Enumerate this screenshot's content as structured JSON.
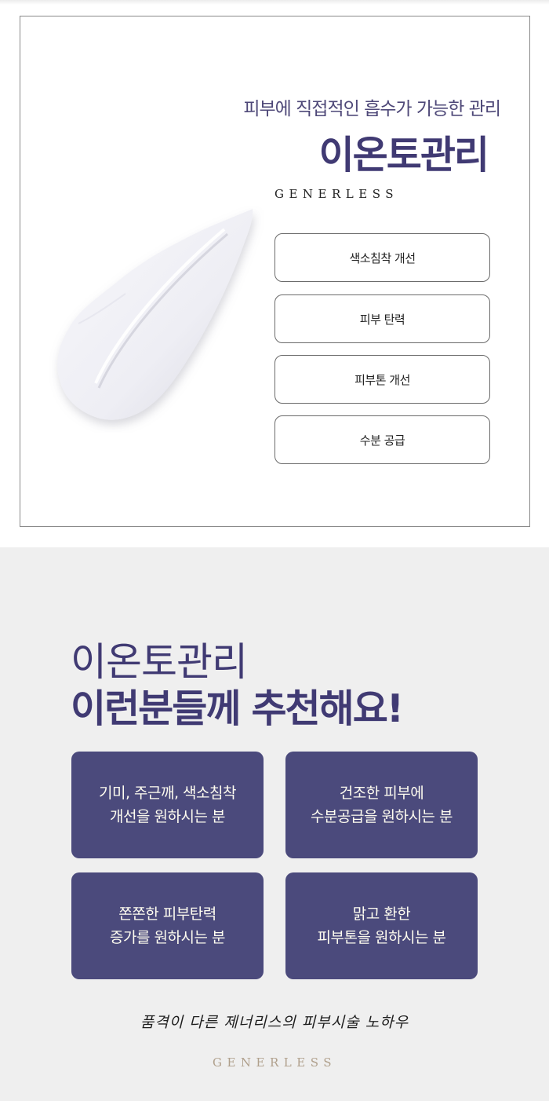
{
  "intro": {
    "subtitle": "피부에 직접적인 흡수가 가능한 관리",
    "title": "이온토관리",
    "brand": "GENERLESS"
  },
  "benefits": [
    {
      "label": "색소침착 개선"
    },
    {
      "label": "피부 탄력"
    },
    {
      "label": "피부톤 개선"
    },
    {
      "label": "수분 공급"
    }
  ],
  "recommend": {
    "title_line1": "이온토관리",
    "title_line2": "이런분들께 추천해요!",
    "cards": [
      {
        "line1": "기미, 주근깨, 색소침착",
        "line2": "개선을 원하시는 분"
      },
      {
        "line1": "건조한 피부에",
        "line2": "수분공급을 원하시는 분"
      },
      {
        "line1": "쫀쫀한 피부탄력",
        "line2": "증가를 원하시는 분"
      },
      {
        "line1": "맑고 환한",
        "line2": "피부톤을 원하시는 분"
      }
    ]
  },
  "footer": {
    "slogan": "품격이 다른 제너리스의 피부시술 노하우",
    "brand": "GENERLESS"
  },
  "colors": {
    "accent": "#403a73",
    "card_bg": "#4b4a7c",
    "card_text": "#fffdf0",
    "section_bg": "#efefef",
    "brand_muted": "#b0a08c"
  }
}
